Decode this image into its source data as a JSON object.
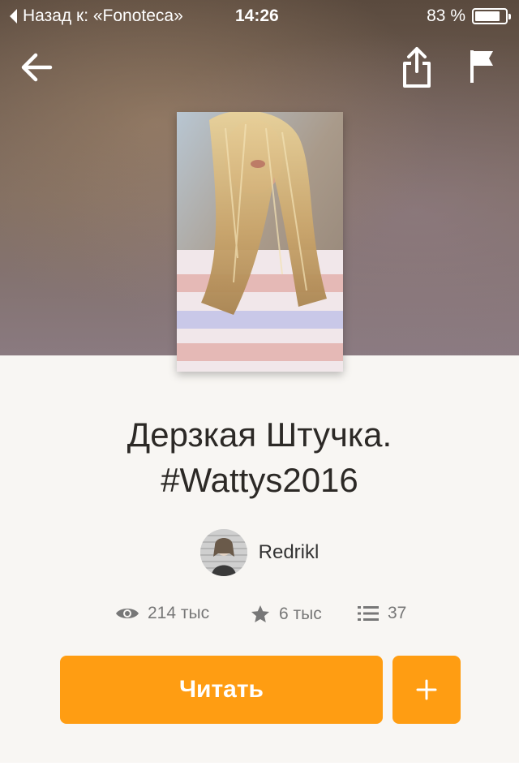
{
  "status_bar": {
    "back_label": "Назад к: «Fonoteca»",
    "time": "14:26",
    "battery_percent_label": "83 %",
    "battery_level": 0.83
  },
  "toolbar": {
    "back_icon": "arrow-left-icon",
    "share_icon": "share-icon",
    "report_icon": "flag-icon"
  },
  "story": {
    "title_line1": "Дерзкая Штучка.",
    "title_line2": "#Wattys2016",
    "author": "Redrikl"
  },
  "stats": {
    "views": "214 тыс",
    "votes": "6 тыс",
    "parts": "37"
  },
  "actions": {
    "read_label": "Читать",
    "add_icon": "plus-icon"
  },
  "colors": {
    "accent": "#ff9d12",
    "background": "#f8f6f3"
  }
}
